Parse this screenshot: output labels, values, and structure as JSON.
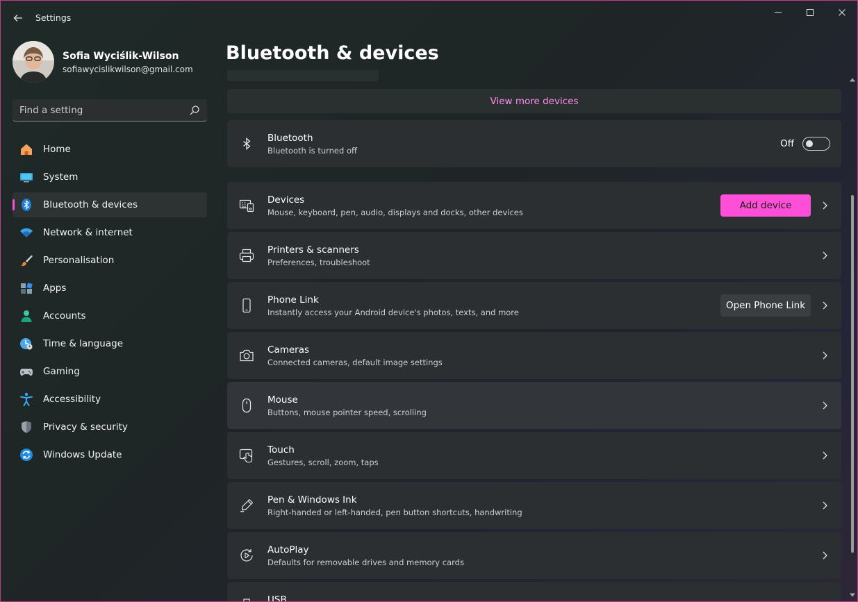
{
  "app": {
    "title": "Settings"
  },
  "profile": {
    "name": "Sofia Wyciślik-Wilson",
    "email": "sofiawycislikwilson@gmail.com"
  },
  "search": {
    "placeholder": "Find a setting"
  },
  "nav": {
    "items": [
      {
        "label": "Home",
        "icon": "home-icon"
      },
      {
        "label": "System",
        "icon": "system-icon"
      },
      {
        "label": "Bluetooth & devices",
        "icon": "bluetooth-icon",
        "active": true
      },
      {
        "label": "Network & internet",
        "icon": "wifi-icon"
      },
      {
        "label": "Personalisation",
        "icon": "brush-icon"
      },
      {
        "label": "Apps",
        "icon": "apps-icon"
      },
      {
        "label": "Accounts",
        "icon": "accounts-icon"
      },
      {
        "label": "Time & language",
        "icon": "clock-globe-icon"
      },
      {
        "label": "Gaming",
        "icon": "gamepad-icon"
      },
      {
        "label": "Accessibility",
        "icon": "accessibility-icon"
      },
      {
        "label": "Privacy & security",
        "icon": "shield-icon"
      },
      {
        "label": "Windows Update",
        "icon": "update-icon"
      }
    ]
  },
  "main": {
    "title": "Bluetooth & devices",
    "view_more": "View more devices",
    "bluetooth": {
      "title": "Bluetooth",
      "subtitle": "Bluetooth is turned off",
      "toggle_state": "Off"
    },
    "cards": [
      {
        "title": "Devices",
        "subtitle": "Mouse, keyboard, pen, audio, displays and docks, other devices",
        "button": "Add device",
        "icon": "devices-icon"
      },
      {
        "title": "Printers & scanners",
        "subtitle": "Preferences, troubleshoot",
        "icon": "printer-icon"
      },
      {
        "title": "Phone Link",
        "subtitle": "Instantly access your Android device's photos, texts, and more",
        "button": "Open Phone Link",
        "icon": "phone-icon"
      },
      {
        "title": "Cameras",
        "subtitle": "Connected cameras, default image settings",
        "icon": "camera-icon"
      },
      {
        "title": "Mouse",
        "subtitle": "Buttons, mouse pointer speed, scrolling",
        "icon": "mouse-icon"
      },
      {
        "title": "Touch",
        "subtitle": "Gestures, scroll, zoom, taps",
        "icon": "touch-icon"
      },
      {
        "title": "Pen & Windows Ink",
        "subtitle": "Right-handed or left-handed, pen button shortcuts, handwriting",
        "icon": "pen-icon"
      },
      {
        "title": "AutoPlay",
        "subtitle": "Defaults for removable drives and memory cards",
        "icon": "autoplay-icon"
      },
      {
        "title": "USB",
        "subtitle": "",
        "icon": "usb-icon"
      }
    ]
  },
  "colors": {
    "accent": "#ff4fd8",
    "link": "#ff8ef0"
  }
}
